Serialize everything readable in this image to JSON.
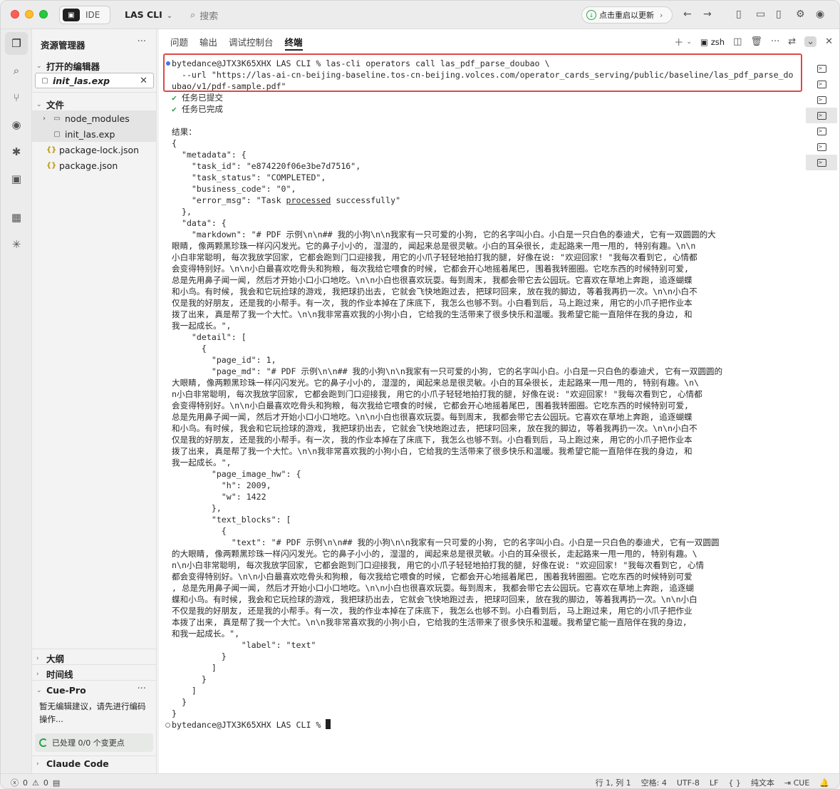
{
  "titlebar": {
    "ide_label": "IDE",
    "project": "LAS CLI",
    "search_placeholder": "搜索",
    "restart_label": "点击重启以更新"
  },
  "sidebar": {
    "title": "资源管理器",
    "open_editors_label": "打开的编辑器",
    "open_file": "init_las.exp",
    "files_label": "文件",
    "files": [
      {
        "name": "node_modules",
        "type": "folder"
      },
      {
        "name": "init_las.exp",
        "type": "file"
      },
      {
        "name": "package-lock.json",
        "type": "json"
      },
      {
        "name": "package.json",
        "type": "json"
      }
    ],
    "outline_label": "大纲",
    "timeline_label": "时间线",
    "cue_label": "Cue-Pro",
    "cue_text": "暂无编辑建议，请先进行编码操作...",
    "cue_status": "已处理 0/0 个变更点",
    "claude_label": "Claude Code"
  },
  "panel": {
    "tabs": [
      "问题",
      "输出",
      "调试控制台",
      "终端"
    ],
    "active_tab": "终端",
    "shell": "zsh"
  },
  "terminal": {
    "cmd_line1": "bytedance@JTX3K65XHX LAS CLI % las-cli operators call las_pdf_parse_doubao \\",
    "cmd_line2": "  --url \"https://las-ai-cn-beijing-baseline.tos-cn-beijing.volces.com/operator_cards_serving/public/baseline/las_pdf_parse_do",
    "cmd_line3": "ubao/v1/pdf-sample.pdf\"",
    "submitted": "任务已提交",
    "completed": "任务已完成",
    "result_label": "结果：",
    "brace_open": "{",
    "metadata_key": "  \"metadata\": {",
    "task_id": "    \"task_id\": \"e874220f06e3be7d7516\",",
    "task_status": "    \"task_status\": \"COMPLETED\",",
    "business_code": "    \"business_code\": \"0\",",
    "error_msg_pre": "    \"error_msg\": \"Task ",
    "error_msg_word": "processed",
    "error_msg_post": " successfully\"",
    "metadata_close": "  },",
    "data_key": "  \"data\": {",
    "markdown_lines": [
      "    \"markdown\": \"# PDF 示例\\n\\n## 我的小狗\\n\\n我家有一只可爱的小狗, 它的名字叫小白。小白是一只白色的泰迪犬, 它有一双圆圆的大",
      "眼睛, 像两颗黑珍珠一样闪闪发光。它的鼻子小小的, 湿湿的, 闻起来总是很灵敏。小白的耳朵很长, 走起路来一甩一甩的, 特别有趣。\\n\\n",
      "小白非常聪明, 每次我放学回家, 它都会跑到门口迎接我, 用它的小爪子轻轻地拍打我的腿, 好像在说: \"欢迎回家! \"我每次看到它, 心情都",
      "会变得特别好。\\n\\n小白最喜欢吃骨头和狗粮, 每次我给它喂食的时候, 它都会开心地摇着尾巴, 围着我转圈圈。它吃东西的时候特别可爱,",
      "总是先用鼻子闻一闻, 然后才开始小口小口地吃。\\n\\n小白也很喜欢玩耍。每到周末, 我都会带它去公园玩。它喜欢在草地上奔跑, 追逐蝴蝶",
      "和小鸟。有时候, 我会和它玩捡球的游戏, 我把球扔出去, 它就会飞快地跑过去, 把球叼回来, 放在我的脚边, 等着我再扔一次。\\n\\n小白不",
      "仅是我的好朋友, 还是我的小帮手。有一次, 我的作业本掉在了床底下, 我怎么也够不到。小白看到后, 马上跑过来, 用它的小爪子把作业本",
      "拨了出来, 真是帮了我一个大忙。\\n\\n我非常喜欢我的小狗小白, 它给我的生活带来了很多快乐和温暖。我希望它能一直陪伴在我的身边, 和",
      "我一起成长。\","
    ],
    "detail_key": "    \"detail\": [",
    "detail_obj_open": "      {",
    "page_id": "        \"page_id\": 1,",
    "page_md_lines": [
      "        \"page_md\": \"# PDF 示例\\n\\n## 我的小狗\\n\\n我家有一只可爱的小狗, 它的名字叫小白。小白是一只白色的泰迪犬, 它有一双圆圆的",
      "大眼睛, 像两颗黑珍珠一样闪闪发光。它的鼻子小小的, 湿湿的, 闻起来总是很灵敏。小白的耳朵很长, 走起路来一甩一甩的, 特别有趣。\\n\\",
      "n小白非常聪明, 每次我放学回家, 它都会跑到门口迎接我, 用它的小爪子轻轻地拍打我的腿, 好像在说: \"欢迎回家! \"我每次看到它, 心情都",
      "会变得特别好。\\n\\n小白最喜欢吃骨头和狗粮, 每次我给它喂食的时候, 它都会开心地摇着尾巴, 围着我转圈圈。它吃东西的时候特别可爱,",
      "总是先用鼻子闻一闻, 然后才开始小口小口地吃。\\n\\n小白也很喜欢玩耍。每到周末, 我都会带它去公园玩。它喜欢在草地上奔跑, 追逐蝴蝶",
      "和小鸟。有时候, 我会和它玩捡球的游戏, 我把球扔出去, 它就会飞快地跑过去, 把球叼回来, 放在我的脚边, 等着我再扔一次。\\n\\n小白不",
      "仅是我的好朋友, 还是我的小帮手。有一次, 我的作业本掉在了床底下, 我怎么也够不到。小白看到后, 马上跑过来, 用它的小爪子把作业本",
      "拨了出来, 真是帮了我一个大忙。\\n\\n我非常喜欢我的小狗小白, 它给我的生活带来了很多快乐和温暖。我希望它能一直陪伴在我的身边, 和",
      "我一起成长。\","
    ],
    "page_image_hw_key": "        \"page_image_hw\": {",
    "h_line": "          \"h\": 2009,",
    "w_line": "          \"w\": 1422",
    "hw_close": "        },",
    "text_blocks_key": "        \"text_blocks\": [",
    "tb_obj_open": "          {",
    "text_lines": [
      "            \"text\": \"# PDF 示例\\n\\n## 我的小狗\\n\\n我家有一只可爱的小狗, 它的名字叫小白。小白是一只白色的泰迪犬, 它有一双圆圆",
      "的大眼睛, 像两颗黑珍珠一样闪闪发光。它的鼻子小小的, 湿湿的, 闻起来总是很灵敏。小白的耳朵很长, 走起路来一甩一甩的, 特别有趣。\\",
      "n\\n小白非常聪明, 每次我放学回家, 它都会跑到门口迎接我, 用它的小爪子轻轻地拍打我的腿, 好像在说: \"欢迎回家! \"我每次看到它, 心情",
      "都会变得特别好。\\n\\n小白最喜欢吃骨头和狗粮, 每次我给它喂食的时候, 它都会开心地摇着尾巴, 围着我转圈圈。它吃东西的时候特别可爱",
      ", 总是先用鼻子闻一闻, 然后才开始小口小口地吃。\\n\\n小白也很喜欢玩耍。每到周末, 我都会带它去公园玩。它喜欢在草地上奔跑, 追逐蝴",
      "蝶和小鸟。有时候, 我会和它玩捡球的游戏, 我把球扔出去, 它就会飞快地跑过去, 把球叼回来, 放在我的脚边, 等着我再扔一次。\\n\\n小白",
      "不仅是我的好朋友, 还是我的小帮手。有一次, 我的作业本掉在了床底下, 我怎么也够不到。小白看到后, 马上跑过来, 用它的小爪子把作业",
      "本拨了出来, 真是帮了我一个大忙。\\n\\n我非常喜欢我的小狗小白, 它给我的生活带来了很多快乐和温暖。我希望它能一直陪伴在我的身边,",
      "和我一起成长。\","
    ],
    "label_line": "              \"label\": \"text\"",
    "tb_obj_close": "          }",
    "tb_close": "        ]",
    "detail_obj_close": "      }",
    "detail_close": "    ]",
    "data_close": "  }",
    "brace_close": "}",
    "final_prompt": "bytedance@JTX3K65XHX LAS CLI % "
  },
  "statusbar": {
    "errors": "0",
    "warnings": "0",
    "position": "行 1, 列 1",
    "spaces": "空格: 4",
    "encoding": "UTF-8",
    "eol": "LF",
    "braces": "{ }",
    "language": "纯文本",
    "cue": "CUE"
  }
}
